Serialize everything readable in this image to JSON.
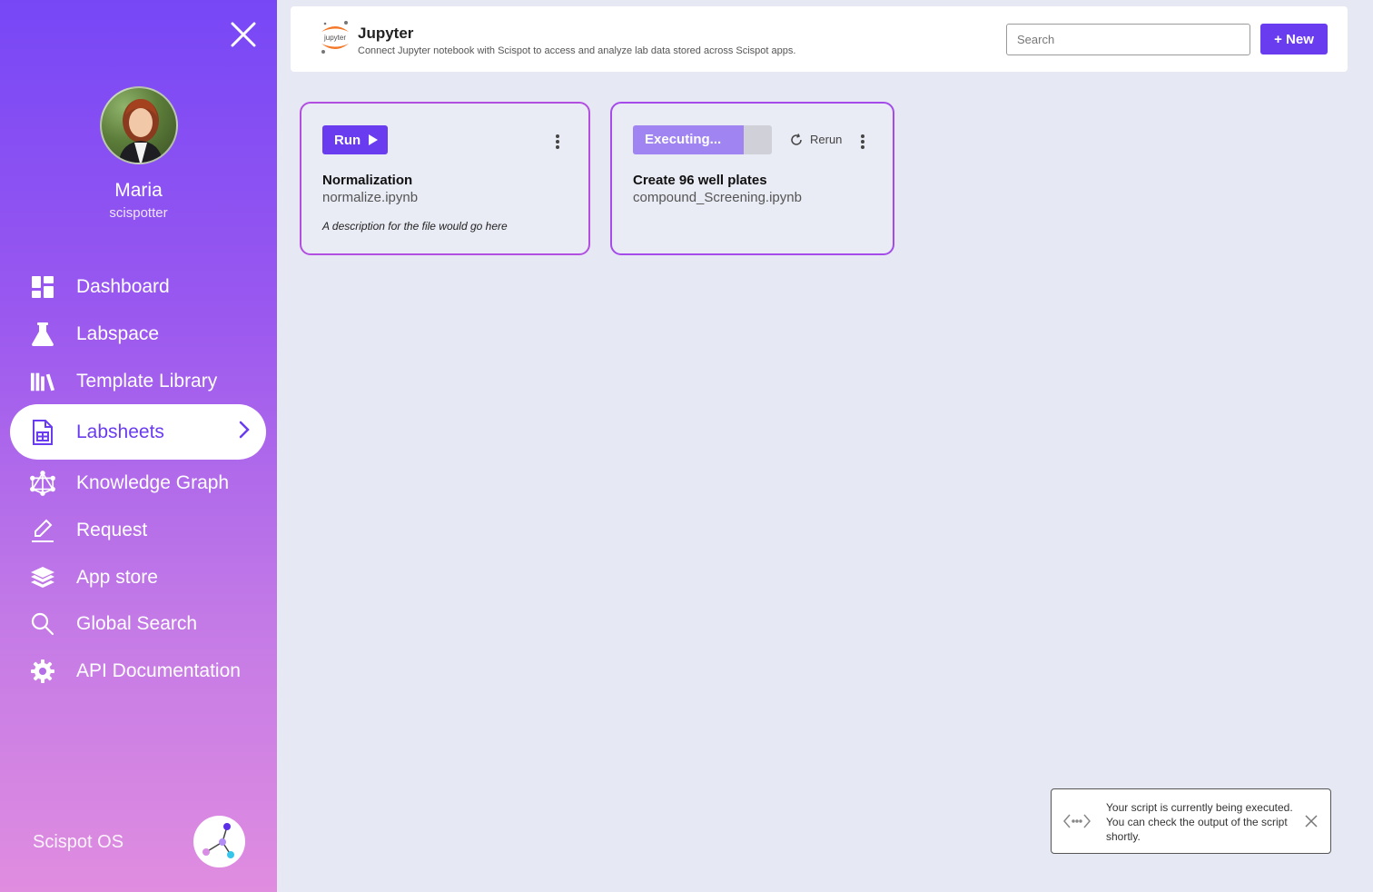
{
  "sidebar": {
    "user": {
      "name": "Maria",
      "handle": "scispotter"
    },
    "items": [
      {
        "label": "Dashboard",
        "icon": "dashboard-icon"
      },
      {
        "label": "Labspace",
        "icon": "flask-icon"
      },
      {
        "label": "Template Library",
        "icon": "library-icon"
      },
      {
        "label": "Labsheets",
        "icon": "spreadsheet-icon",
        "active": true
      },
      {
        "label": "Knowledge Graph",
        "icon": "graph-icon"
      },
      {
        "label": "Request",
        "icon": "pencil-icon"
      },
      {
        "label": "App store",
        "icon": "layers-icon"
      },
      {
        "label": "Global Search",
        "icon": "search-icon"
      },
      {
        "label": "API Documentation",
        "icon": "gear-icon"
      }
    ],
    "brand": "Scispot OS"
  },
  "header": {
    "app_title": "Jupyter",
    "app_logo_text": "jupyter",
    "app_description": "Connect Jupyter notebook with Scispot to access and analyze lab data stored across Scispot apps.",
    "search_placeholder": "Search",
    "new_button": "+ New"
  },
  "cards": [
    {
      "action_label": "Run",
      "title": "Normalization",
      "file": "normalize.ipynb",
      "description": "A description for the file would go here"
    },
    {
      "status_label": "Executing...",
      "progress": 0.8,
      "rerun_label": "Rerun",
      "title": "Create 96 well plates",
      "file": "compound_Screening.ipynb"
    }
  ],
  "toast": {
    "message": "Your script is currently being executed. You can check the output of the script shortly."
  },
  "colors": {
    "accent": "#6a3cf0",
    "progress_fill": "#9f84f2",
    "card_border": "#a44be9"
  }
}
